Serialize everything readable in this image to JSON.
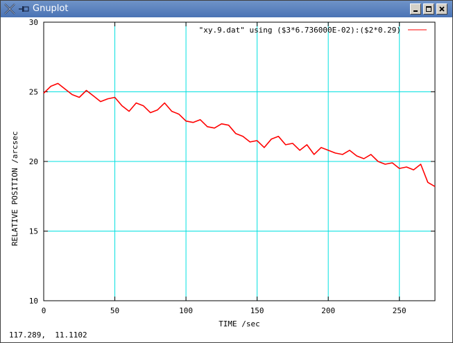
{
  "window": {
    "title": "Gnuplot",
    "titlebar_color": "#5a80be",
    "buttons": [
      "minimize-icon",
      "maximize-icon",
      "close-icon"
    ]
  },
  "status": {
    "coordinates": "117.289,  11.1102"
  },
  "colors": {
    "grid": "#00e0e0",
    "series": "#ff0000",
    "axes": "#000000"
  },
  "chart_data": {
    "type": "line",
    "title": "",
    "xlabel": "TIME /sec",
    "ylabel": "RELATIVE POSITION /arcsec",
    "xlim": [
      0,
      275
    ],
    "ylim": [
      10,
      30
    ],
    "xticks": [
      "0",
      "50",
      "100",
      "150",
      "200",
      "250"
    ],
    "yticks": [
      "10",
      "15",
      "20",
      "25",
      "30"
    ],
    "grid": true,
    "legend": "top-right",
    "series": [
      {
        "name": "\"xy.9.dat\" using ($3*6.736000E-02):($2*0.29)",
        "color": "#ff0000",
        "x": [
          0,
          5,
          10,
          15,
          20,
          25,
          30,
          35,
          40,
          45,
          50,
          55,
          60,
          65,
          70,
          75,
          80,
          85,
          90,
          95,
          100,
          105,
          110,
          115,
          120,
          125,
          130,
          135,
          140,
          145,
          150,
          155,
          160,
          165,
          170,
          175,
          180,
          185,
          190,
          195,
          200,
          205,
          210,
          215,
          220,
          225,
          230,
          235,
          240,
          245,
          250,
          255,
          260,
          265,
          270,
          275
        ],
        "y": [
          24.9,
          25.4,
          25.6,
          25.2,
          24.8,
          24.6,
          25.1,
          24.7,
          24.3,
          24.5,
          24.6,
          24.0,
          23.6,
          24.2,
          24.0,
          23.5,
          23.7,
          24.2,
          23.6,
          23.4,
          22.9,
          22.8,
          23.0,
          22.5,
          22.4,
          22.7,
          22.6,
          22.0,
          21.8,
          21.4,
          21.5,
          21.0,
          21.6,
          21.8,
          21.2,
          21.3,
          20.8,
          21.2,
          20.5,
          21.0,
          20.8,
          20.6,
          20.5,
          20.8,
          20.4,
          20.2,
          20.5,
          20.0,
          19.8,
          19.9,
          19.5,
          19.6,
          19.4,
          19.8,
          18.5,
          18.2
        ]
      }
    ]
  }
}
